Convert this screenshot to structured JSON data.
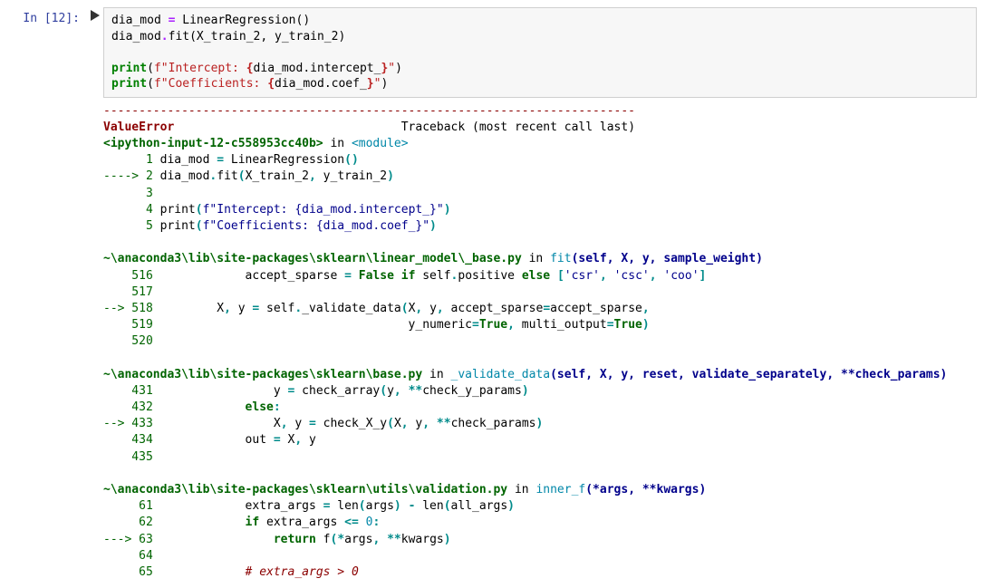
{
  "prompt": "In [12]:",
  "code": {
    "l1a": "dia_mod ",
    "l1b": "=",
    "l1c": " LinearRegression()",
    "l2a": "dia_mod",
    "l2b": ".",
    "l2c": "fit(X_train_2, y_train_2)",
    "l3": "",
    "l4a": "print",
    "l4b": "(",
    "l4c": "f\"Intercept: ",
    "l4d": "{",
    "l4e": "dia_mod.intercept_",
    "l4f": "}",
    "l4g": "\"",
    "l4h": ")",
    "l5a": "print",
    "l5b": "(",
    "l5c": "f\"Coefficients: ",
    "l5d": "{",
    "l5e": "dia_mod.coef_",
    "l5f": "}",
    "l5g": "\"",
    "l5h": ")"
  },
  "tb": {
    "sep": "---------------------------------------------------------------------------",
    "err": "ValueError",
    "recent": "                                Traceback (most recent call last)",
    "f0a": "<ipython-input-12-c558953cc40b>",
    "f0b": " in ",
    "f0c": "<module>",
    "f0l1n": "      1",
    "f0l1t": " dia_mod ",
    "f0l1eq": "=",
    "f0l1r": " LinearRegression",
    "f0l1p": "()",
    "f0arrow": "----> 2",
    "f0l2a": " dia_mod",
    "f0l2b": ".",
    "f0l2c": "fit",
    "f0l2p1": "(",
    "f0l2d": "X_train_2",
    "f0l2comma": ",",
    "f0l2e": " y_train_2",
    "f0l2p2": ")",
    "f0l3n": "      3",
    "f0l4n": "      4",
    "f0l4a": " print",
    "f0l4p1": "(",
    "f0l4b": "f\"Intercept: {dia_mod.intercept_}\"",
    "f0l4p2": ")",
    "f0l5n": "      5",
    "f0l5a": " print",
    "f0l5p1": "(",
    "f0l5b": "f\"Coefficients: {dia_mod.coef_}\"",
    "f0l5p2": ")",
    "blank1": "",
    "f1a": "~\\anaconda3\\lib\\site-packages\\sklearn\\linear_model\\_base.py",
    "f1b": " in ",
    "f1c": "fit",
    "f1d": "(self, X, y, sample_weight)",
    "f1l516n": "    516",
    "f1l516t": "             accept_sparse ",
    "f1l516eq": "=",
    "f1l516f": " False",
    "f1l516if": " if",
    "f1l516s": " self",
    "f1l516dot": ".",
    "f1l516p": "positive ",
    "f1l516el": "else",
    "f1l516b": " [",
    "f1l516s1": "'csr'",
    "f1l516c1": ",",
    "f1l516s2": " 'csc'",
    "f1l516c2": ",",
    "f1l516s3": " 'coo'",
    "f1l516e": "]",
    "f1l517n": "    517",
    "f1arrow": "--> 518",
    "f1l518a": "         X",
    "f1l518c": ",",
    "f1l518b": " y ",
    "f1l518eq": "=",
    "f1l518s": " self",
    "f1l518dot": ".",
    "f1l518m": "_validate_data",
    "f1l518p1": "(",
    "f1l518arg1": "X",
    "f1l518comma1": ",",
    "f1l518arg2": " y",
    "f1l518comma2": ",",
    "f1l518kw1": " accept_sparse",
    "f1l518eq2": "=",
    "f1l518kw1v": "accept_sparse",
    "f1l518comma3": ",",
    "f1l519n": "    519",
    "f1l519pad": "                                    y_numeric",
    "f1l519eq": "=",
    "f1l519t": "True",
    "f1l519c": ",",
    "f1l519m": " multi_output",
    "f1l519eq2": "=",
    "f1l519t2": "True",
    "f1l519p": ")",
    "f1l520n": "    520",
    "blank2": "",
    "f2a": "~\\anaconda3\\lib\\site-packages\\sklearn\\base.py",
    "f2b": " in ",
    "f2c": "_validate_data",
    "f2d": "(self, X, y, reset, validate_separately, **check_params)",
    "f2l431n": "    431",
    "f2l431t": "                 y ",
    "f2l431eq": "=",
    "f2l431m": " check_array",
    "f2l431p1": "(",
    "f2l431a": "y",
    "f2l431c": ",",
    "f2l431st": " ",
    "f2l431star": "**",
    "f2l431k": "check_y_params",
    "f2l431p2": ")",
    "f2l432n": "    432",
    "f2l432t": "             ",
    "f2l432else": "else",
    "f2l432c": ":",
    "f2arrow": "--> 433",
    "f2l433a": "                 X",
    "f2l433c1": ",",
    "f2l433b": " y ",
    "f2l433eq": "=",
    "f2l433m": " check_X_y",
    "f2l433p1": "(",
    "f2l433x": "X",
    "f2l433c2": ",",
    "f2l433y": " y",
    "f2l433c3": ",",
    "f2l433sp": " ",
    "f2l433star": "**",
    "f2l433k": "check_params",
    "f2l433p2": ")",
    "f2l434n": "    434",
    "f2l434t": "             out ",
    "f2l434eq": "=",
    "f2l434r": " X",
    "f2l434c": ",",
    "f2l434y": " y",
    "f2l435n": "    435",
    "blank3": "",
    "f3a": "~\\anaconda3\\lib\\site-packages\\sklearn\\utils\\validation.py",
    "f3b": " in ",
    "f3c": "inner_f",
    "f3d": "(*args, **kwargs)",
    "f3l61n": "     61",
    "f3l61t": "             extra_args ",
    "f3l61eq": "=",
    "f3l61m": " len",
    "f3l61p1": "(",
    "f3l61a": "args",
    "f3l61p2": ")",
    "f3l61mi": " -",
    "f3l61m2": " len",
    "f3l61p3": "(",
    "f3l61a2": "all_args",
    "f3l61p4": ")",
    "f3l62n": "     62",
    "f3l62pad": "             ",
    "f3l62if": "if",
    "f3l62t": " extra_args ",
    "f3l62op": "<=",
    "f3l62z": " 0",
    "f3l62c": ":",
    "f3arrow": "---> 63",
    "f3l63pad": "                 ",
    "f3l63r": "return",
    "f3l63f": " f",
    "f3l63p1": "(",
    "f3l63s1": "*",
    "f3l63a": "args",
    "f3l63c": ",",
    "f3l63sp": " ",
    "f3l63s2": "**",
    "f3l63k": "kwargs",
    "f3l63p2": ")",
    "f3l64n": "     64",
    "f3l65n": "     65",
    "f3l65pad": "             ",
    "f3l65c": "# extra_args > 0"
  }
}
